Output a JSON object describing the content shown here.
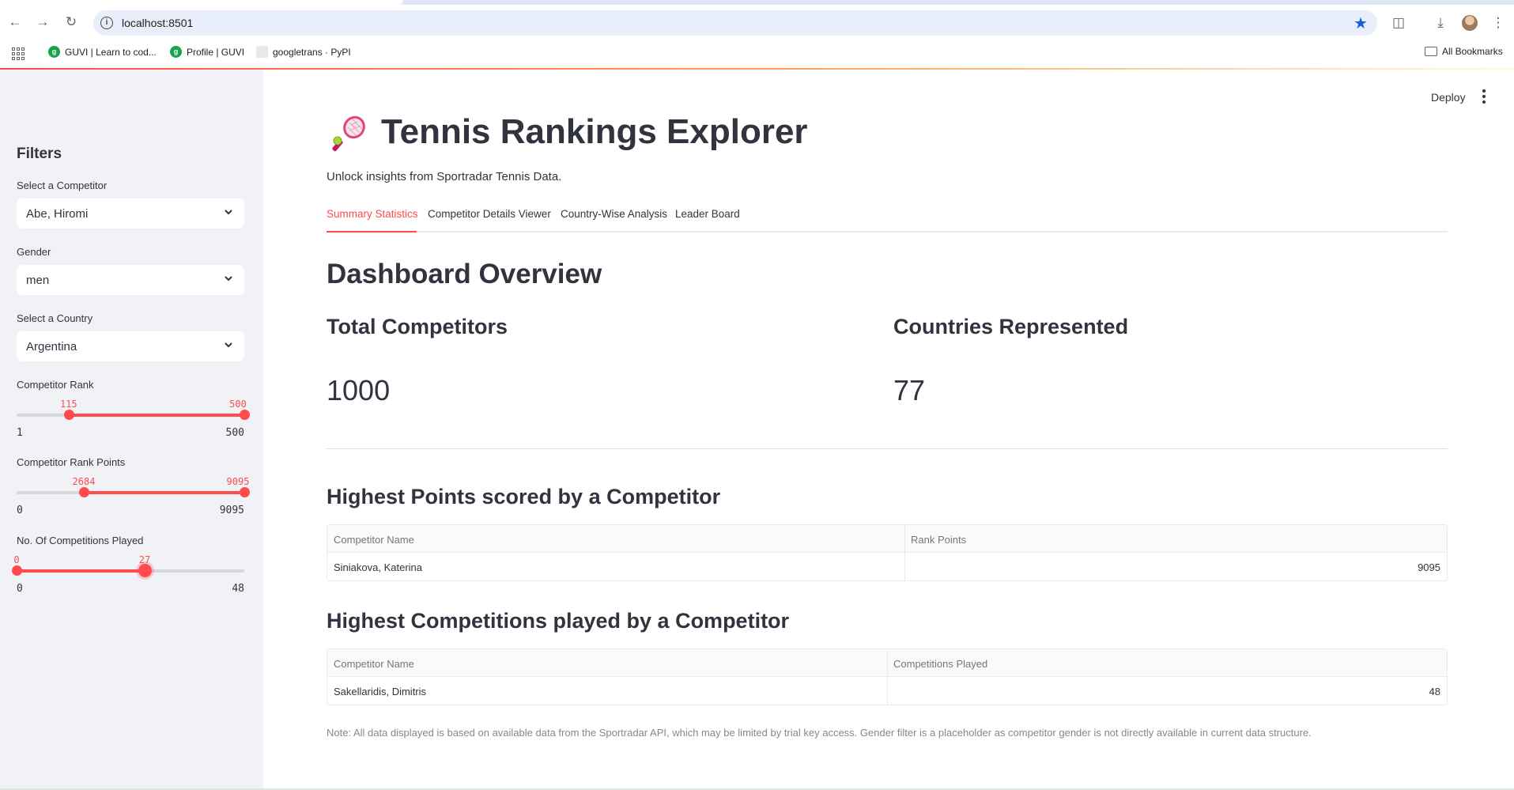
{
  "browser": {
    "url": "localhost:8501",
    "bookmarks": [
      {
        "label": "GUVI | Learn to cod..."
      },
      {
        "label": "Profile | GUVI"
      },
      {
        "label": "googletrans · PyPI"
      }
    ],
    "all_bookmarks_label": "All Bookmarks"
  },
  "header": {
    "deploy_label": "Deploy"
  },
  "app": {
    "title": "Tennis Rankings Explorer",
    "subtitle": "Unlock insights from Sportradar Tennis Data.",
    "tabs": [
      {
        "label": "Summary Statistics",
        "active": true
      },
      {
        "label": "Competitor Details Viewer",
        "active": false
      },
      {
        "label": "Country-Wise Analysis",
        "active": false
      },
      {
        "label": "Leader Board",
        "active": false
      }
    ]
  },
  "sidebar": {
    "heading": "Filters",
    "competitor_select": {
      "label": "Select a Competitor",
      "value": "Abe, Hiromi"
    },
    "gender_select": {
      "label": "Gender",
      "value": "men"
    },
    "country_select": {
      "label": "Select a Country",
      "value": "Argentina"
    },
    "rank_slider": {
      "label": "Competitor Rank",
      "min": "1",
      "max": "500",
      "low": "115",
      "high": "500",
      "low_value": 115,
      "high_value": 500,
      "min_value": 1,
      "max_value": 500
    },
    "points_slider": {
      "label": "Competitor Rank Points",
      "min": "0",
      "max": "9095",
      "low": "2684",
      "high": "9095",
      "low_value": 2684,
      "high_value": 9095,
      "min_value": 0,
      "max_value": 9095
    },
    "competitions_slider": {
      "label": "No. Of Competitions Played",
      "min": "0",
      "max": "48",
      "low": "0",
      "high": "27",
      "low_value": 0,
      "high_value": 27,
      "min_value": 0,
      "max_value": 48
    }
  },
  "overview": {
    "title": "Dashboard Overview",
    "metrics": [
      {
        "label": "Total Competitors",
        "value": "1000"
      },
      {
        "label": "Countries Represented",
        "value": "77"
      }
    ]
  },
  "highest_points": {
    "title": "Highest Points scored by a Competitor",
    "columns": [
      "Competitor Name",
      "Rank Points"
    ],
    "rows": [
      [
        "Siniakova, Katerina",
        "9095"
      ]
    ]
  },
  "highest_competitions": {
    "title": "Highest Competitions played by a Competitor",
    "columns": [
      "Competitor Name",
      "Competitions Played"
    ],
    "rows": [
      [
        "Sakellaridis, Dimitris",
        "48"
      ]
    ]
  },
  "note": "Note: All data displayed is based on available data from the Sportradar API, which may be limited by trial key access. Gender filter is a placeholder as competitor gender is not directly available in current data structure.",
  "colors": {
    "accent": "#ff4b4b",
    "sidebar_bg": "#f0f2f6",
    "text": "#31333f"
  }
}
